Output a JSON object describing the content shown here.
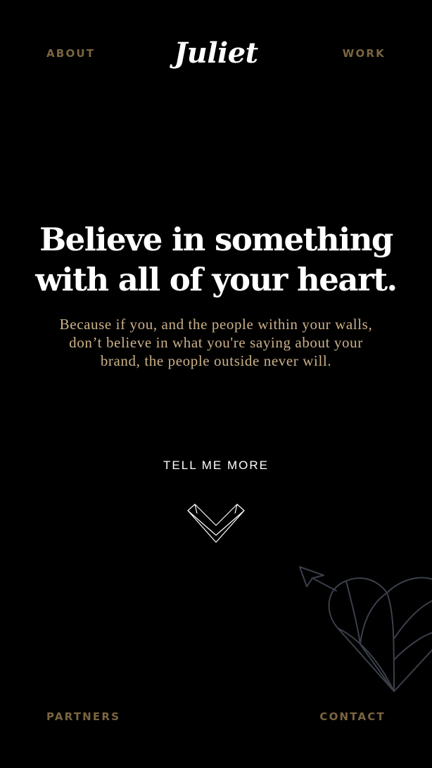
{
  "brand": {
    "logo_text": "Juliet"
  },
  "nav": {
    "about": "ABOUT",
    "work": "WORK",
    "partners": "PARTNERS",
    "contact": "CONTACT"
  },
  "hero": {
    "headline": "Believe in something with all of your heart.",
    "subtext": "Because if you, and the people within your walls, don’t believe in what you're saying about your brand, the people outside never will.",
    "cta_label": "TELL ME MORE"
  },
  "colors": {
    "background": "#000000",
    "nav_gold": "#7a6540",
    "subtext_gold": "#cbb189",
    "headline_white": "#ffffff",
    "heart_outline": "#3a3f4a"
  },
  "icons": {
    "scroll_down": "chevron-down-icon",
    "decoration": "heart-arrow-icon"
  }
}
